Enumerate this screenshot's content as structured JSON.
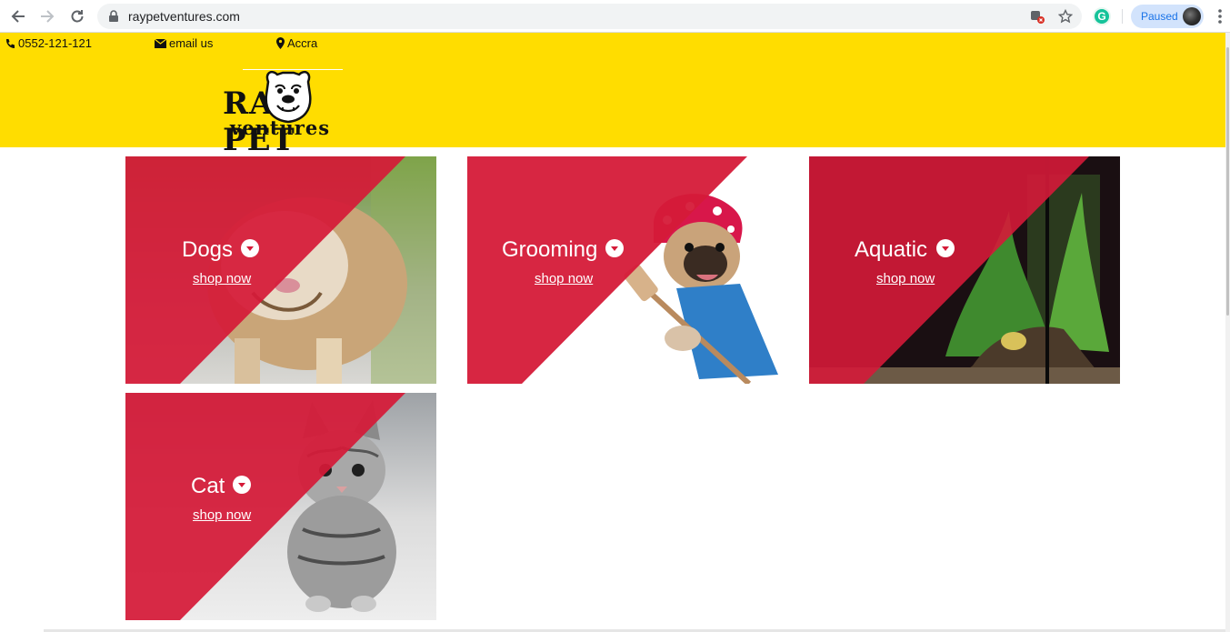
{
  "browser": {
    "url": "raypetventures.com",
    "profile_label": "Paused",
    "extension_letter": "G"
  },
  "header": {
    "phone": "0552-121-121",
    "email_label": "email us",
    "location": "Accra",
    "logo_word_top": "RAY PET",
    "logo_word_bottom": "ventures",
    "background": "#ffdd00"
  },
  "categories": [
    {
      "name": "Dogs",
      "link": "shop now"
    },
    {
      "name": "Grooming",
      "link": "shop now"
    },
    {
      "name": "Aquatic",
      "link": "shop now"
    },
    {
      "name": "Cat",
      "link": "shop now"
    }
  ],
  "colors": {
    "accent_red": "#d51a38",
    "header_yellow": "#ffdd00"
  }
}
